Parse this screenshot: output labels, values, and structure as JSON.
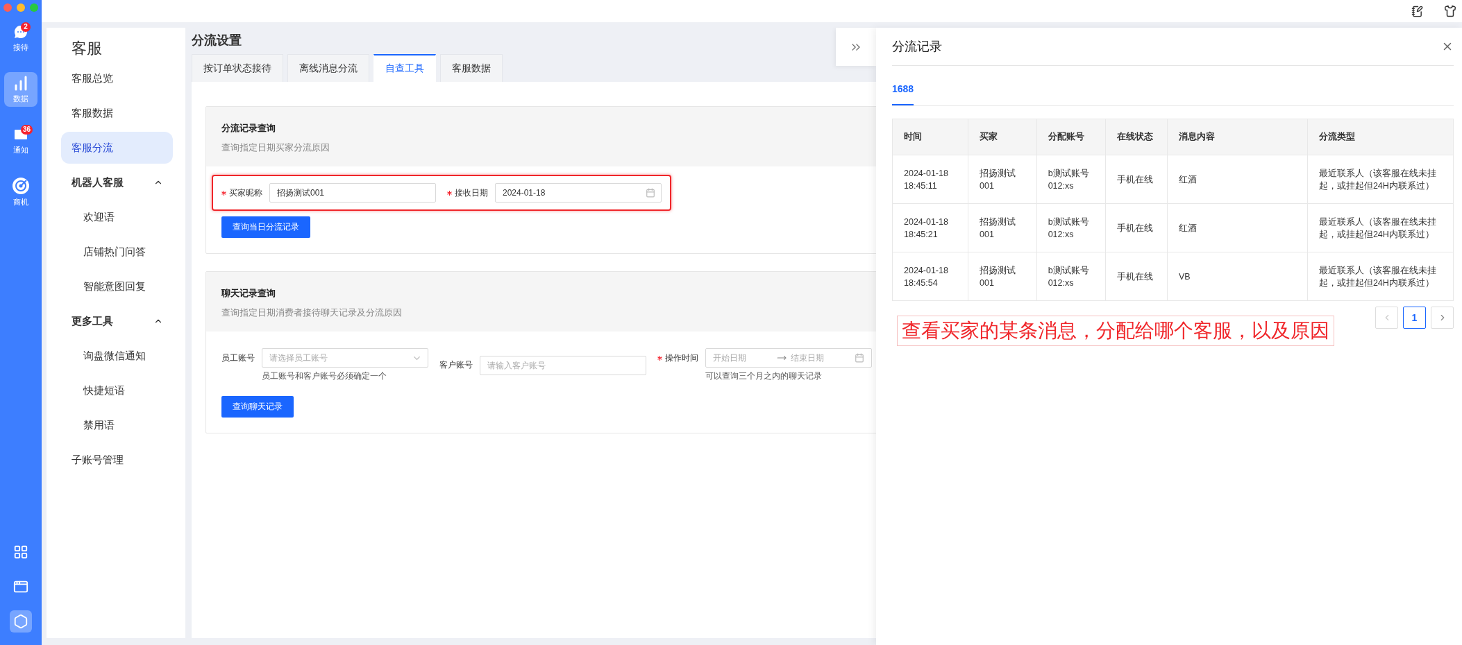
{
  "rail": {
    "items": [
      {
        "label": "接待",
        "badge": "2",
        "selected": false
      },
      {
        "label": "数据",
        "selected": true
      },
      {
        "label": "通知",
        "badge": "36",
        "selected": false
      },
      {
        "label": "商机",
        "selected": false
      }
    ],
    "tools": [
      {
        "selected": false
      },
      {
        "selected": false
      },
      {
        "selected": true
      }
    ]
  },
  "sidebar": {
    "title": "客服",
    "items": [
      {
        "label": "客服总览",
        "selected": false
      },
      {
        "label": "客服数据",
        "selected": false
      },
      {
        "label": "客服分流",
        "selected": true
      },
      {
        "label": "机器人客服",
        "expanded": true,
        "children": [
          {
            "label": "欢迎语",
            "selected": false
          },
          {
            "label": "店铺热门问答",
            "selected": false
          },
          {
            "label": "智能意图回复",
            "selected": false
          }
        ]
      },
      {
        "label": "更多工具",
        "expanded": true,
        "children": [
          {
            "label": "询盘微信通知",
            "selected": false
          },
          {
            "label": "快捷短语",
            "selected": false
          },
          {
            "label": "禁用语",
            "selected": false
          }
        ]
      },
      {
        "label": "子账号管理",
        "selected": false
      }
    ]
  },
  "page": {
    "title": "分流设置",
    "tabs": [
      {
        "label": "按订单状态接待",
        "selected": false
      },
      {
        "label": "离线消息分流",
        "selected": false
      },
      {
        "label": "自查工具",
        "selected": true
      },
      {
        "label": "客服数据",
        "selected": false
      }
    ]
  },
  "cards": [
    {
      "title": "分流记录查询",
      "subtitle": "查询指定日期买家分流原因",
      "highlighted": true,
      "fields": [
        {
          "kind": "text",
          "label": "买家昵称",
          "required": true,
          "value": "招扬测试001"
        },
        {
          "kind": "date",
          "label": "接收日期",
          "required": true,
          "value": "2024-01-18"
        }
      ],
      "button": "查询当日分流记录"
    },
    {
      "title": "聊天记录查询",
      "subtitle": "查询指定日期消费者接待聊天记录及分流原因",
      "highlighted": false,
      "fields": [
        {
          "kind": "select",
          "label": "员工账号",
          "required": false,
          "placeholder": "请选择员工账号",
          "hint": "员工账号和客户账号必须确定一个"
        },
        {
          "kind": "text",
          "label": "客户账号",
          "required": false,
          "placeholder": "请输入客户账号"
        },
        {
          "kind": "range",
          "label": "操作时间",
          "required": true,
          "start_placeholder": "开始日期",
          "end_placeholder": "结束日期",
          "hint": "可以查询三个月之内的聊天记录"
        }
      ],
      "button": "查询聊天记录"
    }
  ],
  "drawer": {
    "title": "分流记录",
    "tabs": [
      {
        "label": "1688",
        "selected": true
      }
    ],
    "table": {
      "columns": [
        "时间",
        "买家",
        "分配账号",
        "在线状态",
        "消息内容",
        "分流类型"
      ],
      "rows": [
        [
          "2024-01-18 18:45:11",
          "招扬测试001",
          "b测试账号012:xs",
          "手机在线",
          "红酒",
          "最近联系人（该客服在线未挂起，或挂起但24H内联系过）"
        ],
        [
          "2024-01-18 18:45:21",
          "招扬测试001",
          "b测试账号012:xs",
          "手机在线",
          "红酒",
          "最近联系人（该客服在线未挂起，或挂起但24H内联系过）"
        ],
        [
          "2024-01-18 18:45:54",
          "招扬测试001",
          "b测试账号012:xs",
          "手机在线",
          "VB",
          "最近联系人（该客服在线未挂起，或挂起但24H内联系过）"
        ]
      ]
    },
    "pagination": {
      "prev_disabled": true,
      "next_disabled": false,
      "pages": [
        {
          "label": "1",
          "selected": true
        }
      ]
    }
  },
  "annotation": "查看买家的某条消息，分配给哪个客服，以及原因"
}
